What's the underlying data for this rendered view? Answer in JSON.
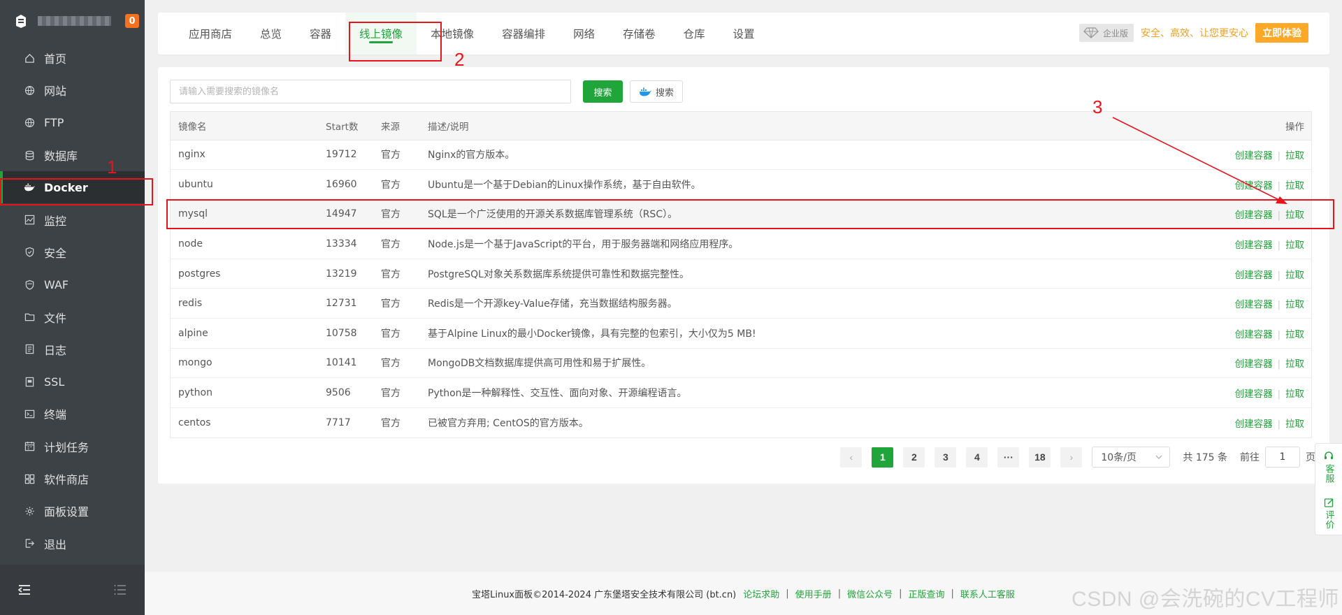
{
  "sidebar": {
    "badge": "0",
    "items": [
      {
        "label": "首页",
        "icon": "home-icon"
      },
      {
        "label": "网站",
        "icon": "globe-icon"
      },
      {
        "label": "FTP",
        "icon": "ftp-globe-icon"
      },
      {
        "label": "数据库",
        "icon": "database-icon"
      },
      {
        "label": "Docker",
        "icon": "docker-icon",
        "active": true
      },
      {
        "label": "监控",
        "icon": "monitor-icon"
      },
      {
        "label": "安全",
        "icon": "shield-icon"
      },
      {
        "label": "WAF",
        "icon": "waf-shield-icon"
      },
      {
        "label": "文件",
        "icon": "folder-icon"
      },
      {
        "label": "日志",
        "icon": "log-icon"
      },
      {
        "label": "SSL",
        "icon": "ssl-icon"
      },
      {
        "label": "终端",
        "icon": "terminal-icon"
      },
      {
        "label": "计划任务",
        "icon": "calendar-icon"
      },
      {
        "label": "软件商店",
        "icon": "store-icon"
      },
      {
        "label": "面板设置",
        "icon": "gear-icon"
      },
      {
        "label": "退出",
        "icon": "logout-icon"
      }
    ]
  },
  "annotations": {
    "n1": "1",
    "n2": "2",
    "n3": "3"
  },
  "tabs": [
    {
      "label": "应用商店"
    },
    {
      "label": "总览"
    },
    {
      "label": "容器"
    },
    {
      "label": "线上镜像",
      "active": true
    },
    {
      "label": "本地镜像"
    },
    {
      "label": "容器编排"
    },
    {
      "label": "网络"
    },
    {
      "label": "存储卷"
    },
    {
      "label": "仓库"
    },
    {
      "label": "设置"
    }
  ],
  "promo": {
    "edition": "企业版",
    "text": "安全、高效、让您更安心",
    "button": "立即体验"
  },
  "search": {
    "placeholder": "请输入需要搜索的镜像名",
    "value": "",
    "button": "搜索",
    "docker_button": "搜索"
  },
  "table": {
    "headers": {
      "name": "镜像名",
      "stars": "Start数",
      "source": "来源",
      "desc": "描述/说明",
      "op": "操作"
    },
    "op_create": "创建容器",
    "op_sep": "|",
    "op_pull": "拉取",
    "rows": [
      {
        "name": "nginx",
        "stars": "19712",
        "source": "官方",
        "desc": "Nginx的官方版本。"
      },
      {
        "name": "ubuntu",
        "stars": "16960",
        "source": "官方",
        "desc": "Ubuntu是一个基于Debian的Linux操作系统，基于自由软件。"
      },
      {
        "name": "mysql",
        "stars": "14947",
        "source": "官方",
        "desc": "SQL是一个广泛使用的开源关系数据库管理系统（RSC）。",
        "highlight": true
      },
      {
        "name": "node",
        "stars": "13334",
        "source": "官方",
        "desc": "Node.js是一个基于JavaScript的平台，用于服务器端和网络应用程序。"
      },
      {
        "name": "postgres",
        "stars": "13219",
        "source": "官方",
        "desc": "PostgreSQL对象关系数据库系统提供可靠性和数据完整性。"
      },
      {
        "name": "redis",
        "stars": "12731",
        "source": "官方",
        "desc": "Redis是一个开源key-Value存储，充当数据结构服务器。"
      },
      {
        "name": "alpine",
        "stars": "10758",
        "source": "官方",
        "desc": "基于Alpine Linux的最小Docker镜像，具有完整的包索引，大小仅为5 MB!"
      },
      {
        "name": "mongo",
        "stars": "10141",
        "source": "官方",
        "desc": "MongoDB文档数据库提供高可用性和易于扩展性。"
      },
      {
        "name": "python",
        "stars": "9506",
        "source": "官方",
        "desc": "Python是一种解释性、交互性、面向对象、开源编程语言。"
      },
      {
        "name": "centos",
        "stars": "7717",
        "source": "官方",
        "desc": "已被官方弃用; CentOS的官方版本。"
      }
    ]
  },
  "pagination": {
    "prev": "‹",
    "pages": [
      "1",
      "2",
      "3",
      "4",
      "···",
      "18"
    ],
    "current": "1",
    "next": "›",
    "page_size": "10条/页",
    "total": "共 175 条",
    "goto_label": "前往",
    "goto_value": "1",
    "page_suffix": "页"
  },
  "float": {
    "service": "客服",
    "review": "评价"
  },
  "footer": {
    "copyright": "宝塔Linux面板©2014-2024 广东堡塔安全技术有限公司 (bt.cn)",
    "links": [
      "论坛求助",
      "使用手册",
      "微信公众号",
      "正版查询",
      "联系人工客服"
    ],
    "sep": "|"
  },
  "watermark": "CSDN @会洗碗的CV工程师",
  "colors": {
    "accent": "#20a53a",
    "sidebar_bg": "#3d4246",
    "annotation": "#e8141c",
    "promo": "#fda827"
  }
}
